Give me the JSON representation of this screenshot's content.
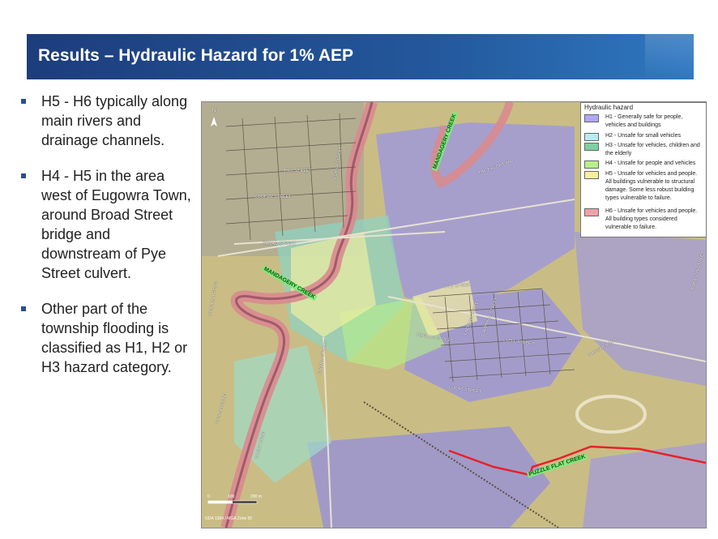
{
  "slide": {
    "title": "Results – Hydraulic Hazard for 1% AEP",
    "bullets": [
      "H5 - H6 typically along main rivers and drainage channels.",
      "H4 - H5 in the area west of Eugowra Town, around Broad Street bridge and downstream of Pye Street culvert.",
      "Other part of the township flooding is classified as H1, H2 or H3 hazard category."
    ]
  },
  "map": {
    "legend": {
      "title": "Hydraulic hazard",
      "items": [
        {
          "text": "H1 - Generally safe for people, vehicles and buildings",
          "color": "#b0a8f0"
        },
        {
          "text": "H2 - Unsafe for small vehicles",
          "color": "#b7ecf0"
        },
        {
          "text": "H3 - Unsafe for vehicles, children and the elderly",
          "color": "#7fd0a0"
        },
        {
          "text": "H4 - Unsafe for people and vehicles",
          "color": "#b6f08a"
        },
        {
          "text": "H5 - Unsafe for vehicles and people. All buildings vulnerable to structural damage. Some less robust building types vulnerable to failure.",
          "color": "#f5efa0"
        },
        {
          "text": "H6 - Unsafe for vehicles and people. All building types considered vulnerable to failure.",
          "color": "#f0a0a8"
        }
      ]
    },
    "street_labels": {
      "hill": "HILL STREET",
      "norsa": "NORSA STREET",
      "cooper": "COOPER STREET",
      "broad": "BROAD STREET",
      "pye": "PYE STREET",
      "escort": "THE ESCORT WAY",
      "wyndham": "WYNDHAM ROAD",
      "nanima": "NANIMA STREET",
      "oberon": "OBERON STREET",
      "lyell": "LYELL STREET",
      "lachlan": "LACHLAN STREET",
      "campbell": "CAMPBELL STREET",
      "lucas": "LUCAS STREET",
      "nangar": "NANGAR ROAD",
      "baragon": "BARAGON STREET",
      "fulham": "FULHAM ROAD",
      "cluny": "CLUNY ROAD"
    },
    "creek_labels": {
      "mandagery_north": "MANDAGERY CREEK",
      "mandagery_south": "MANDAGERY CREEK",
      "puzzle": "PUZZLE FLAT CREEK"
    },
    "north_label": "N",
    "scale": [
      "0",
      "100",
      "200 m"
    ],
    "coord_system": "GDA 1994 / MGA Zone 55"
  }
}
